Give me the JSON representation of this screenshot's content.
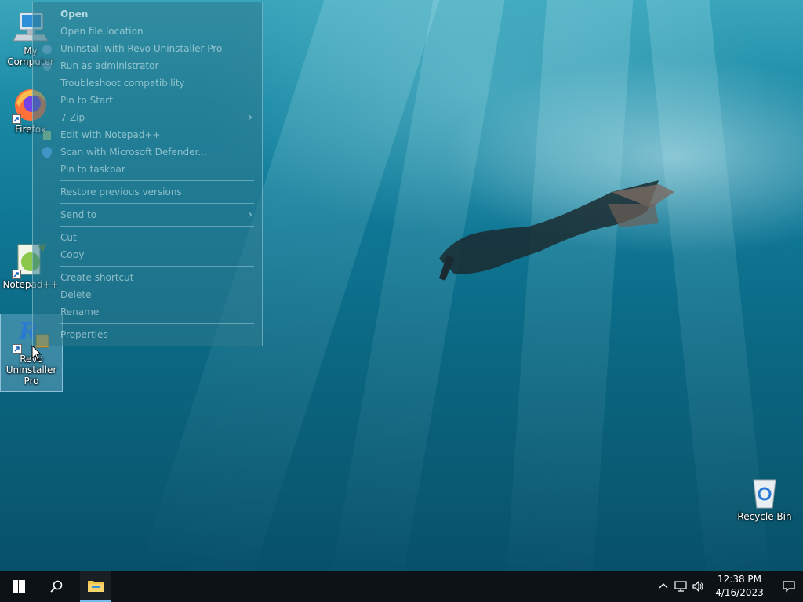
{
  "desktop": {
    "icons": [
      {
        "id": "my-computer",
        "label": "My Computer"
      },
      {
        "id": "firefox",
        "label": "Firefox"
      },
      {
        "id": "notepadpp",
        "label": "Notepad++"
      },
      {
        "id": "revo",
        "label_lines": [
          "Revo",
          "Uninstaller",
          "Pro"
        ]
      },
      {
        "id": "recycle-bin",
        "label": "Recycle Bin"
      }
    ]
  },
  "context_menu": {
    "items": [
      {
        "label": "Open",
        "bold": true
      },
      {
        "label": "Open file location"
      },
      {
        "label": "Uninstall with Revo Uninstaller Pro",
        "icon": "revo-icon"
      },
      {
        "label": "Run as administrator",
        "icon": "shield-admin-icon"
      },
      {
        "label": "Troubleshoot compatibility"
      },
      {
        "label": "Pin to Start"
      },
      {
        "label": "7-Zip",
        "submenu": true
      },
      {
        "label": "Edit with Notepad++",
        "icon": "notepadpp-icon"
      },
      {
        "label": "Scan with Microsoft Defender...",
        "icon": "defender-shield-icon"
      },
      {
        "label": "Pin to taskbar"
      },
      {
        "label": "Restore previous versions"
      },
      {
        "label": "Send to",
        "submenu": true
      },
      {
        "label": "Cut"
      },
      {
        "label": "Copy"
      },
      {
        "label": "Create shortcut"
      },
      {
        "label": "Delete"
      },
      {
        "label": "Rename"
      },
      {
        "label": "Properties"
      }
    ],
    "submenu_arrow": "›"
  },
  "taskbar": {
    "clock": {
      "time": "12:38 PM",
      "date": "4/16/2023"
    },
    "icons": [
      "windows-start-icon",
      "search-icon",
      "file-explorer-icon",
      "chevron-up-icon",
      "network-icon",
      "volume-icon",
      "notification-icon"
    ]
  },
  "colors": {
    "accent": "#2b788c",
    "taskbar": "#0c1216"
  }
}
